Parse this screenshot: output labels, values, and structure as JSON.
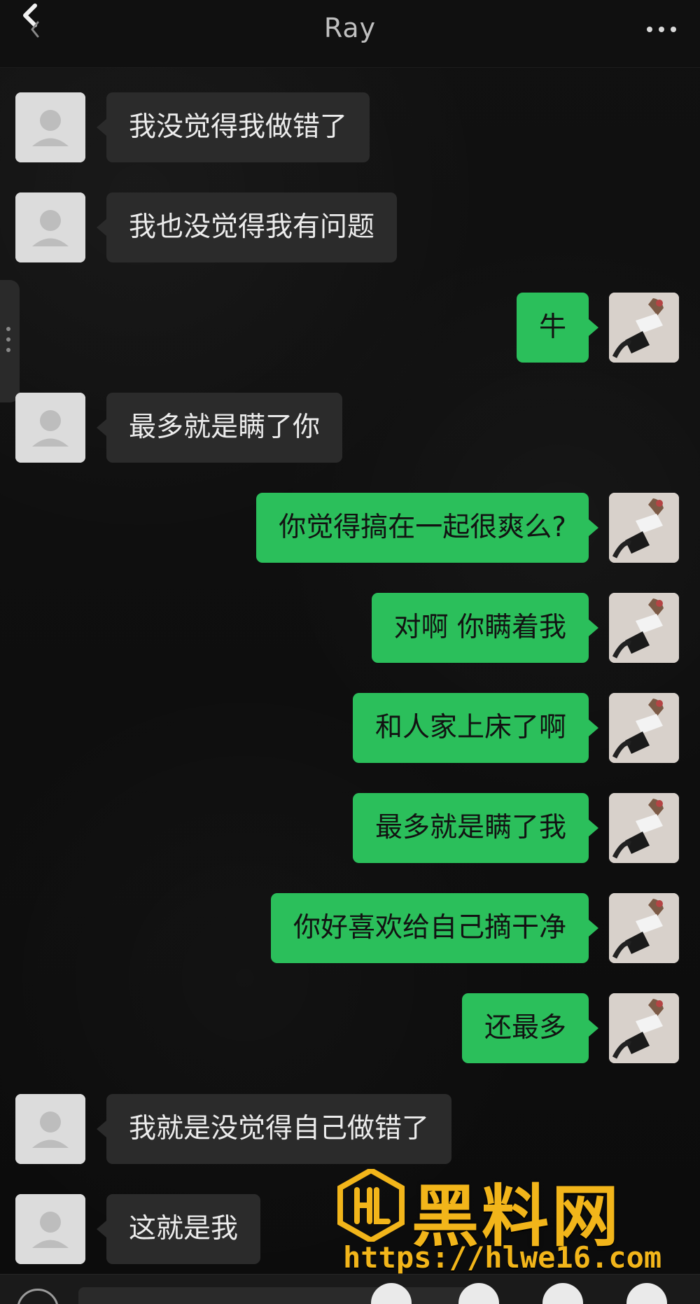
{
  "header": {
    "title": "Ray",
    "back_icon": "chevron-left-icon",
    "more_icon": "more-icon"
  },
  "messages": [
    {
      "side": "left",
      "text": "我没觉得我做错了"
    },
    {
      "side": "left",
      "text": "我也没觉得我有问题"
    },
    {
      "side": "right",
      "text": "牛"
    },
    {
      "side": "left",
      "text": "最多就是瞒了你"
    },
    {
      "side": "right",
      "text": "你觉得搞在一起很爽么?"
    },
    {
      "side": "right",
      "text": "对啊 你瞒着我"
    },
    {
      "side": "right",
      "text": "和人家上床了啊"
    },
    {
      "side": "right",
      "text": "最多就是瞒了我"
    },
    {
      "side": "right",
      "text": "你好喜欢给自己摘干净"
    },
    {
      "side": "right",
      "text": "还最多"
    },
    {
      "side": "left",
      "text": "我就是没觉得自己做错了"
    },
    {
      "side": "left",
      "text": "这就是我"
    }
  ],
  "watermark": {
    "title": "黑料网",
    "url": "https://hlwe16.com"
  },
  "colors": {
    "background": "#0f0f0f",
    "incoming_bubble": "#2b2b2b",
    "outgoing_bubble": "#2bbf5b",
    "watermark": "#f2b51a"
  }
}
